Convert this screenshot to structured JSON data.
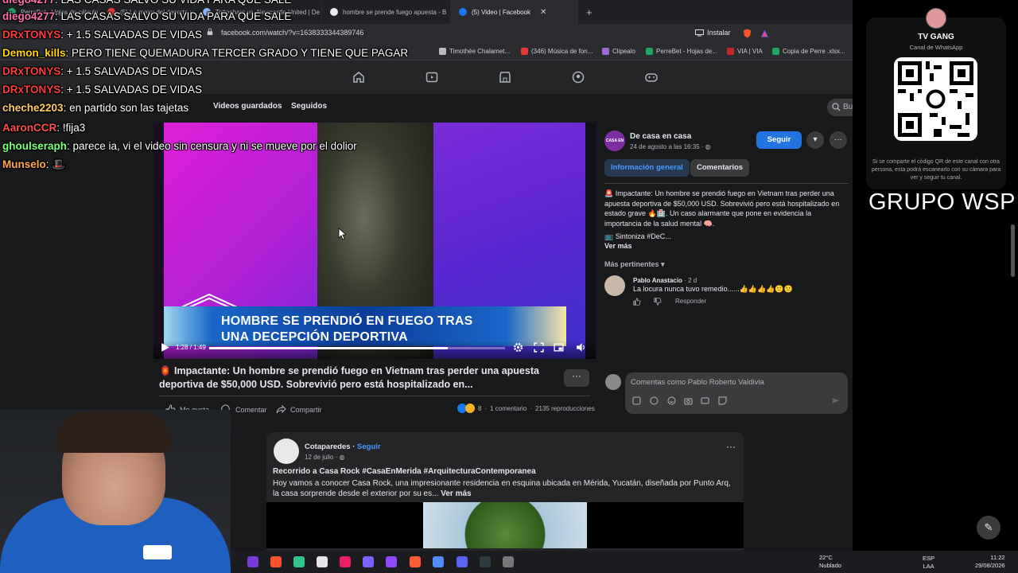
{
  "browser": {
    "tabs": [
      {
        "label": "PerreBet - Hojas de cálculo de Google"
      },
      {
        "label": "(5) Lo mejor del deporte y el entretenimiento"
      },
      {
        "label": "Tottenham vs. Newcastle United | De"
      },
      {
        "label": "hombre se prende fuego apuesta - B"
      },
      {
        "label": "(5) Video | Facebook"
      }
    ],
    "url": "facebook.com/watch/?v=1638333344389746",
    "install_label": "Instalar",
    "bookmarks": [
      {
        "label": "Timothée Chalamet..."
      },
      {
        "label": "(346) Música de fon..."
      },
      {
        "label": "Clipealo"
      },
      {
        "label": "PerreBet - Hojas de..."
      },
      {
        "label": "VIA | VIA"
      },
      {
        "label": "Copia de Perre .xlsx..."
      }
    ]
  },
  "fb": {
    "subnav": [
      "Videos guardados",
      "Seguidos"
    ],
    "search_placeholder": "Bu",
    "video": {
      "banner_line1": "HOMBRE SE PRENDIÓ EN FUEGO TRAS",
      "banner_line2": "UNA DECEPCIÓN DEPORTIVA",
      "time": "1:28 / 1:49",
      "progress": 0.807
    },
    "post_title": "🏮 Impactante: Un hombre se prendió fuego en Vietnam tras perder una apuesta deportiva de $50,000 USD. Sobrevivió pero está hospitalizado en...",
    "actions": {
      "like": "Me gusta",
      "comment": "Comentar",
      "share": "Compartir"
    },
    "stats": {
      "reactions": "8",
      "comments": "1 comentario",
      "views": "2135 reproducciones"
    },
    "panel": {
      "page_name": "De casa en casa",
      "avatar_text": "CASA EN CASA",
      "date": "24 de agosto a las 16:35 · ",
      "follow": "Seguir",
      "tab_info": "Información general",
      "tab_comments": "Comentarios",
      "description": "🚨 Impactante: Un hombre se prendió fuego en Vietnam tras perder una apuesta deportiva de $50,000 USD. Sobrevivió pero está hospitalizado en estado grave 🔥🏥. Un caso alarmante que pone en evidencia la importancia de la salud mental 🧠.",
      "sintoniza": "📺 Sintoniza #DeC...",
      "ver_mas": "Ver más",
      "sort": "Más pertinentes",
      "comment_author": "Pablo Anastacio",
      "comment_time": " · 2 d",
      "comment_text": "La locura nunca tuvo remedio......👍👍👍👍🙁🙁",
      "reply": "Responder",
      "compose_placeholder": "Comentas como Pablo Roberto Valdivia"
    },
    "post2": {
      "author": "Cotaparedes",
      "follow": "Seguir",
      "date": "12 de julio · ",
      "title": "Recorrido a Casa Rock #CasaEnMerida #ArquitecturaContemporanea",
      "text": "Hoy vamos a conocer Casa Rock, una impresionante residencia en esquina ubicada en Mérida, Yucatán, diseñada por Punto Arq, la casa sorprende desde el exterior por su es...",
      "ver_mas": "Ver más"
    }
  },
  "whatsapp": {
    "name": "TV GANG",
    "sub": "Canal de WhatsApp",
    "note": "Si se comparte el código QR de este canal con otra persona, esta podrá escanearlo con su cámara para ver y seguir tu canal."
  },
  "grupo": "GRUPO WSP",
  "chat": [
    {
      "user": "diego4277",
      "msg": ": LAS CASAS SALVO SU VIDA PARA QUE SALE",
      "color": "#ff6fb0"
    },
    {
      "user": "diego4277",
      "msg": ": LAS CASAS SALVO SU VIDA PARA QUE SALE",
      "color": "#ff6fb0"
    },
    {
      "user": "DRxTONYS",
      "msg": ": + 1.5 SALVADAS DE VIDAS",
      "color": "#ff3b3b"
    },
    {
      "user": "Demon_kills",
      "msg": ": PERO TIENE QUEMADURA TERCER GRADO Y TIENE QUE PAGAR",
      "color": "#ffd700"
    },
    {
      "user": "DRxTONYS",
      "msg": ": + 1.5 SALVADAS DE VIDAS",
      "color": "#ff3b3b"
    },
    {
      "user": "DRxTONYS",
      "msg": ": + 1.5 SALVADAS DE VIDAS",
      "color": "#ff3b3b"
    },
    {
      "user": "cheche2203",
      "msg": ": en partido son las tajetas",
      "color": "#ffcf5a"
    },
    {
      "user": "AaronCCR",
      "msg": ": !fija3",
      "color": "#ff4d4d"
    },
    {
      "user": "ghoulseraph",
      "msg": ": parece ia, vi el video sin censura y ni se mueve por el dolior",
      "color": "#7dff7d"
    },
    {
      "user": "Munselo",
      "msg": ": 🎩",
      "color": "#ffa64d"
    }
  ],
  "system": {
    "temp": "22°C",
    "weather": "Nublado",
    "lang1": "ESP",
    "lang2": "LAA",
    "time": "11:22",
    "date": "29/08/2026"
  }
}
